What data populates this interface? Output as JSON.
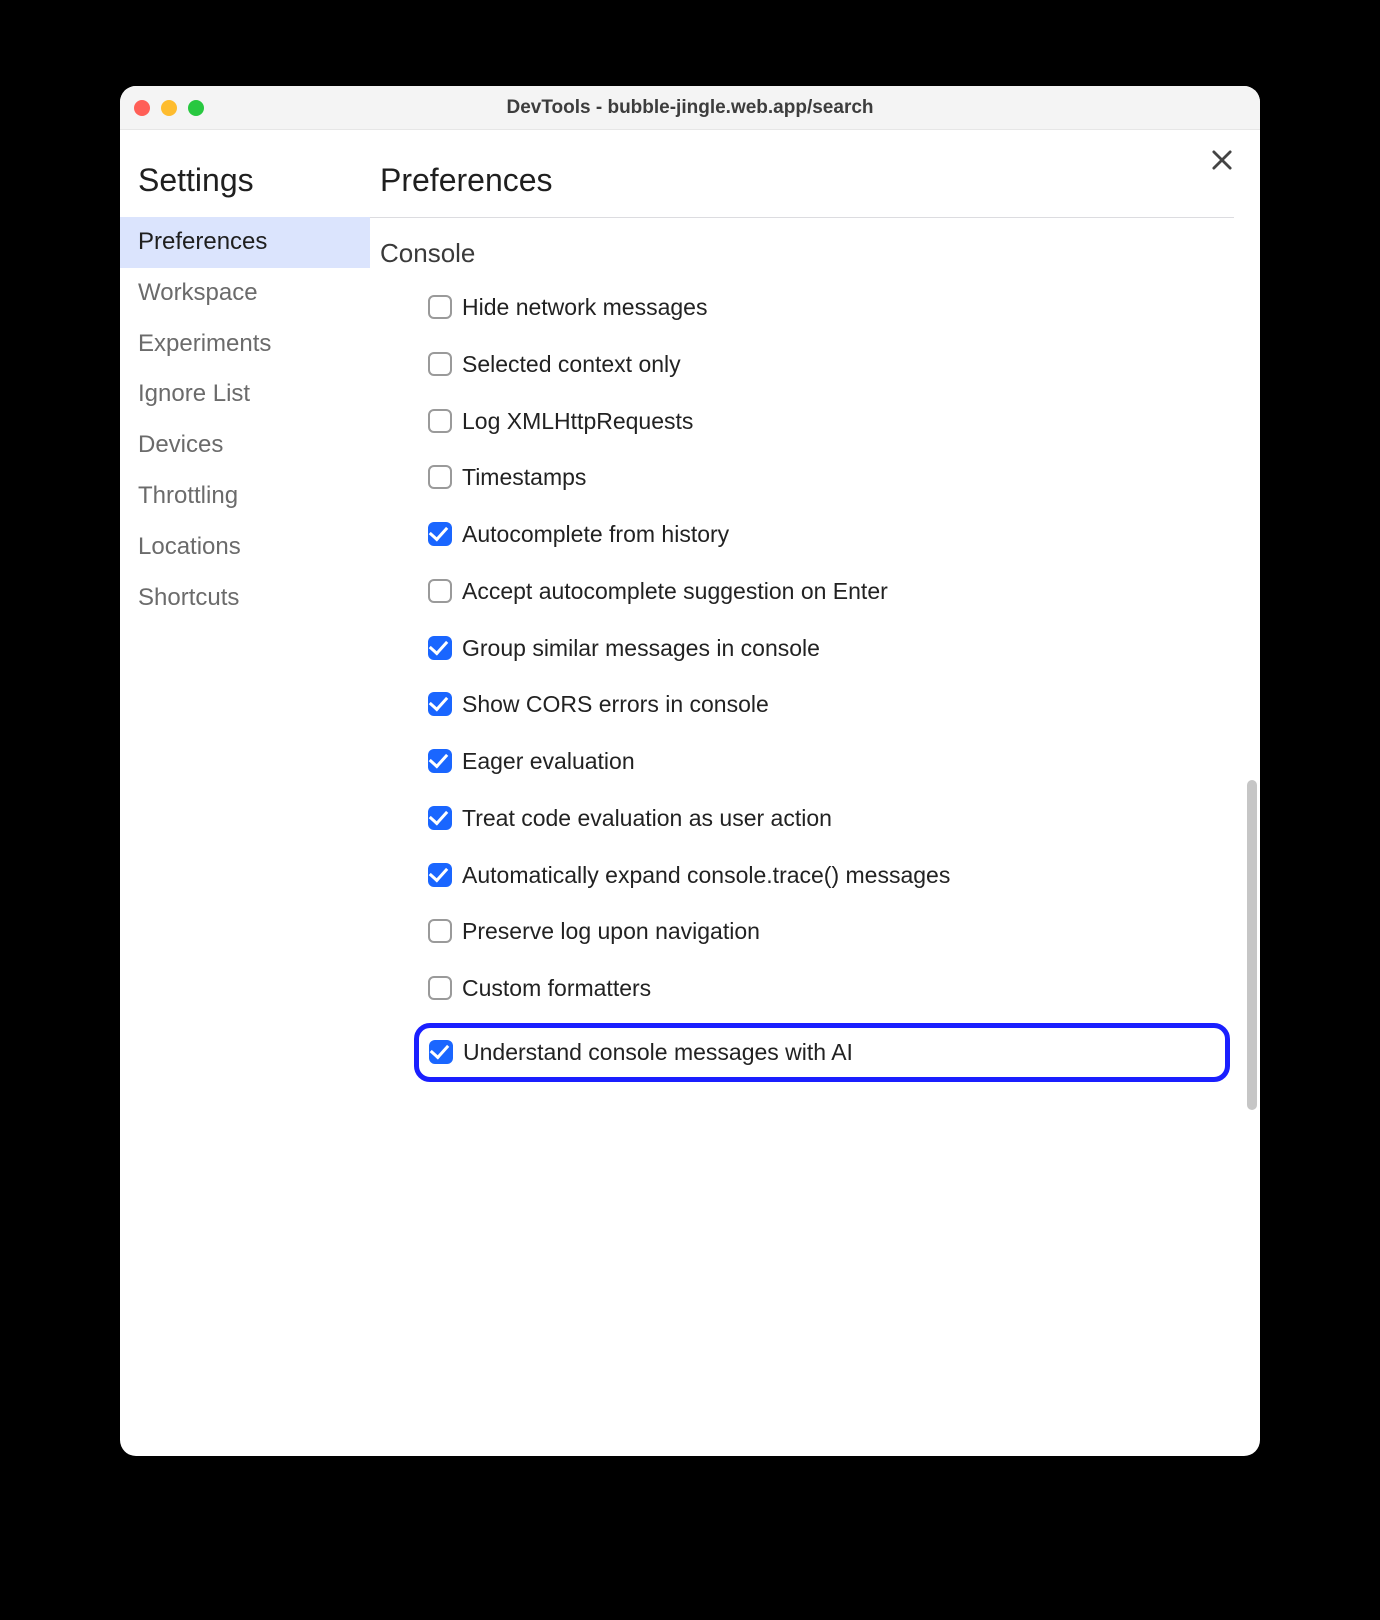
{
  "window": {
    "title": "DevTools - bubble-jingle.web.app/search"
  },
  "sidebar": {
    "title": "Settings",
    "items": [
      {
        "label": "Preferences",
        "active": true
      },
      {
        "label": "Workspace",
        "active": false
      },
      {
        "label": "Experiments",
        "active": false
      },
      {
        "label": "Ignore List",
        "active": false
      },
      {
        "label": "Devices",
        "active": false
      },
      {
        "label": "Throttling",
        "active": false
      },
      {
        "label": "Locations",
        "active": false
      },
      {
        "label": "Shortcuts",
        "active": false
      }
    ]
  },
  "main": {
    "title": "Preferences",
    "section": "Console",
    "options": [
      {
        "label": "Hide network messages",
        "checked": false
      },
      {
        "label": "Selected context only",
        "checked": false
      },
      {
        "label": "Log XMLHttpRequests",
        "checked": false
      },
      {
        "label": "Timestamps",
        "checked": false
      },
      {
        "label": "Autocomplete from history",
        "checked": true
      },
      {
        "label": "Accept autocomplete suggestion on Enter",
        "checked": false
      },
      {
        "label": "Group similar messages in console",
        "checked": true
      },
      {
        "label": "Show CORS errors in console",
        "checked": true
      },
      {
        "label": "Eager evaluation",
        "checked": true
      },
      {
        "label": "Treat code evaluation as user action",
        "checked": true
      },
      {
        "label": "Automatically expand console.trace() messages",
        "checked": true
      },
      {
        "label": "Preserve log upon navigation",
        "checked": false
      },
      {
        "label": "Custom formatters",
        "checked": false
      },
      {
        "label": "Understand console messages with AI",
        "checked": true,
        "highlighted": true
      }
    ]
  }
}
